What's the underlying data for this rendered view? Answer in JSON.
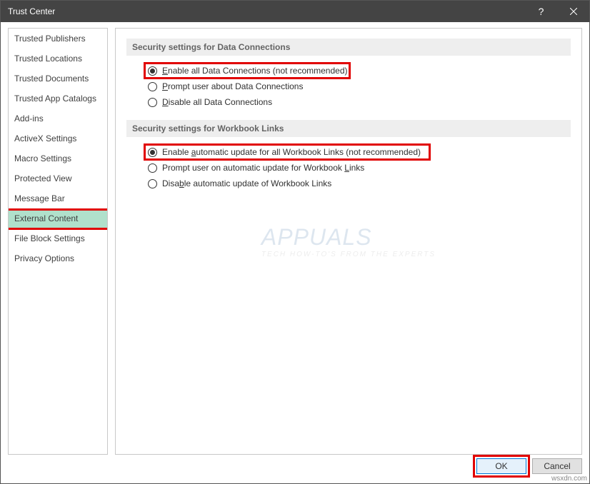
{
  "window": {
    "title": "Trust Center",
    "help_label": "?",
    "close_label": "×"
  },
  "sidebar": {
    "items": [
      {
        "label": "Trusted Publishers",
        "selected": false
      },
      {
        "label": "Trusted Locations",
        "selected": false
      },
      {
        "label": "Trusted Documents",
        "selected": false
      },
      {
        "label": "Trusted App Catalogs",
        "selected": false
      },
      {
        "label": "Add-ins",
        "selected": false
      },
      {
        "label": "ActiveX Settings",
        "selected": false
      },
      {
        "label": "Macro Settings",
        "selected": false
      },
      {
        "label": "Protected View",
        "selected": false
      },
      {
        "label": "Message Bar",
        "selected": false
      },
      {
        "label": "External Content",
        "selected": true
      },
      {
        "label": "File Block Settings",
        "selected": false
      },
      {
        "label": "Privacy Options",
        "selected": false
      }
    ]
  },
  "sections": {
    "dataConnections": {
      "title": "Security settings for Data Connections",
      "options": [
        {
          "pre": "",
          "u": "E",
          "post": "nable all Data Connections (not recommended)",
          "checked": true,
          "highlighted": true
        },
        {
          "pre": "",
          "u": "P",
          "post": "rompt user about Data Connections",
          "checked": false,
          "highlighted": false
        },
        {
          "pre": "",
          "u": "D",
          "post": "isable all Data Connections",
          "checked": false,
          "highlighted": false
        }
      ]
    },
    "workbookLinks": {
      "title": "Security settings for Workbook Links",
      "options": [
        {
          "pre": "Enable ",
          "u": "a",
          "post": "utomatic update for all Workbook Links (not recommended)",
          "checked": true,
          "highlighted": true
        },
        {
          "pre": "Prompt user on automatic update for Workbook ",
          "u": "L",
          "post": "inks",
          "checked": false,
          "highlighted": false
        },
        {
          "pre": "Disa",
          "u": "b",
          "post": "le automatic update of Workbook Links",
          "checked": false,
          "highlighted": false
        }
      ]
    }
  },
  "buttons": {
    "ok": "OK",
    "cancel": "Cancel"
  },
  "watermark": {
    "main": "APPUALS",
    "sub": "TECH HOW-TO'S FROM THE EXPERTS"
  },
  "source_tag": "wsxdn.com"
}
